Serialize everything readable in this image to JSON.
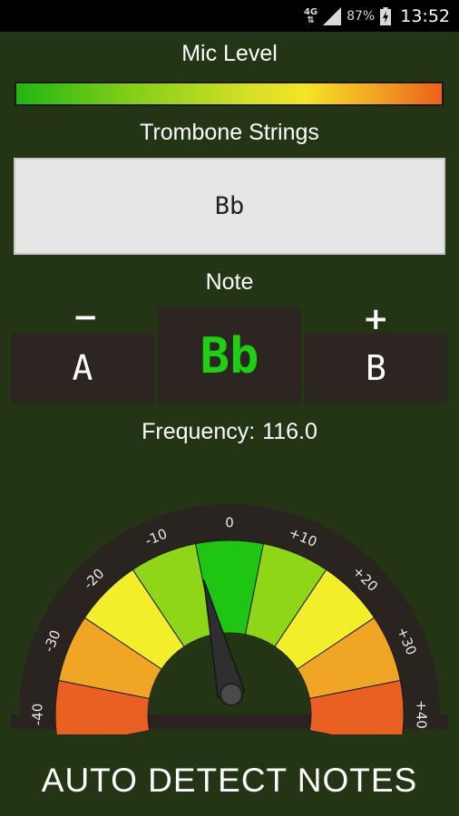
{
  "status_bar": {
    "network": "4G",
    "battery_percent": "87%",
    "time": "13:52"
  },
  "mic": {
    "label": "Mic Level"
  },
  "strings": {
    "label": "Trombone Strings",
    "selected": "Bb"
  },
  "note": {
    "label": "Note",
    "minus_sign": "−",
    "plus_sign": "+",
    "previous": "A",
    "current": "Bb",
    "next": "B"
  },
  "frequency": {
    "label": "Frequency:",
    "value": "116.0"
  },
  "gauge": {
    "ticks": [
      "-40",
      "-30",
      "-20",
      "-10",
      "0",
      "+10",
      "+20",
      "+30",
      "+40"
    ],
    "needle_cents": -6,
    "colors": {
      "center": "#1ec512",
      "near": "#8fd619",
      "mid": "#f3ee2a",
      "far": "#f0a524",
      "outer": "#ea6022"
    }
  },
  "auto_detect": {
    "label": "AUTO DETECT NOTES"
  }
}
